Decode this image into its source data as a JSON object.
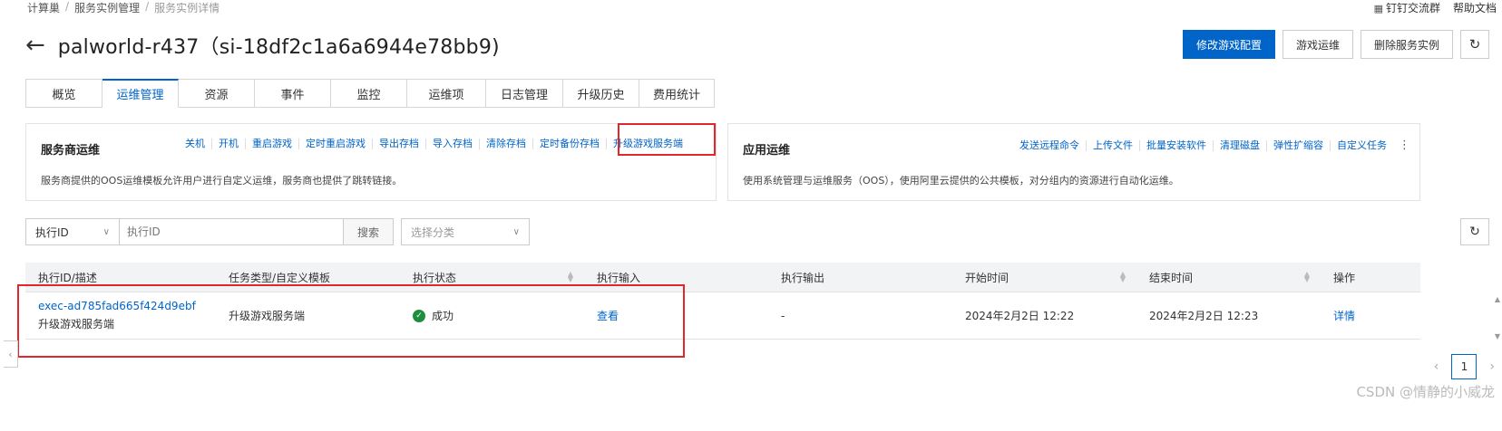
{
  "breadcrumb": [
    "计算巢",
    "服务实例管理",
    "服务实例详情"
  ],
  "top_links": [
    {
      "icon": "dingtalk-icon",
      "label": "钉钉交流群"
    },
    {
      "label": "帮助文档"
    }
  ],
  "page_title": "palworld-r437（si-18df2c1a6a6944e78bb9)",
  "actions": {
    "modify": "修改游戏配置",
    "ops": "游戏运维",
    "delete": "删除服务实例",
    "refresh_icon": "refresh-icon"
  },
  "tabs": [
    "概览",
    "运维管理",
    "资源",
    "事件",
    "监控",
    "运维项",
    "日志管理",
    "升级历史",
    "费用统计"
  ],
  "provider_panel": {
    "title": "服务商运维",
    "links": [
      "关机",
      "开机",
      "重启游戏",
      "定时重启游戏",
      "导出存档",
      "导入存档",
      "清除存档",
      "定时备份存档",
      "升级游戏服务端"
    ],
    "desc": "服务商提供的OOS运维模板允许用户进行自定义运维，服务商也提供了跳转链接。"
  },
  "app_panel": {
    "title": "应用运维",
    "links": [
      "发送远程命令",
      "上传文件",
      "批量安装软件",
      "清理磁盘",
      "弹性扩缩容",
      "自定义任务"
    ],
    "more": "⋮",
    "desc": "使用系统管理与运维服务（OOS），使用阿里云提供的公共模板，对分组内的资源进行自动化运维。"
  },
  "filter": {
    "field": "执行ID",
    "placeholder": "执行ID",
    "search": "搜索",
    "category_placeholder": "选择分类"
  },
  "table": {
    "headers": [
      "执行ID/描述",
      "任务类型/自定义模板",
      "执行状态",
      "执行输入",
      "执行输出",
      "开始时间",
      "结束时间",
      "操作"
    ],
    "rows": [
      {
        "id": "exec-ad785fad665f424d9ebf",
        "desc": "升级游戏服务端",
        "type": "升级游戏服务端",
        "status": "成功",
        "input": "查看",
        "output": "-",
        "start": "2024年2月2日 12:22",
        "end": "2024年2月2日 12:23",
        "op": "详情"
      }
    ]
  },
  "pager": {
    "current": "1"
  },
  "watermark": "CSDN @情静的小威龙",
  "colors": {
    "primary": "#0064c8",
    "highlight": "#e3262b",
    "success": "#1e8e3e"
  }
}
